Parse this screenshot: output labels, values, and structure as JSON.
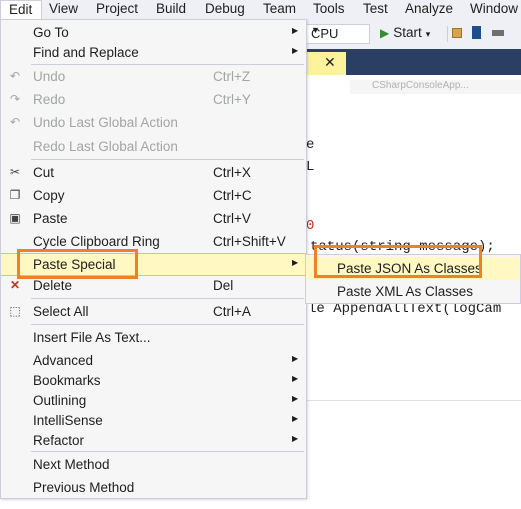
{
  "menubar": {
    "items": [
      "Edit",
      "View",
      "Project",
      "Build",
      "Debug",
      "Team",
      "Tools",
      "Test",
      "Analyze",
      "Window"
    ]
  },
  "toolbar": {
    "platform": "CPU",
    "start_label": "Start"
  },
  "editor": {
    "fragments": [
      "e",
      "L",
      "0",
      "tatus(string message);",
      "le AppendAllText(logCam"
    ],
    "crumb": "CSharpConsoleApp..."
  },
  "edit_menu": {
    "items": [
      {
        "label": "Go To",
        "shortcut": "",
        "submenu": true,
        "disabled": false,
        "icon": ""
      },
      {
        "label": "Find and Replace",
        "shortcut": "",
        "submenu": true,
        "disabled": false,
        "icon": ""
      },
      {
        "label": "Undo",
        "shortcut": "Ctrl+Z",
        "submenu": false,
        "disabled": true,
        "icon": "undo-icon"
      },
      {
        "label": "Redo",
        "shortcut": "Ctrl+Y",
        "submenu": false,
        "disabled": true,
        "icon": "redo-icon"
      },
      {
        "label": "Undo Last Global Action",
        "shortcut": "",
        "submenu": false,
        "disabled": true,
        "icon": "undo-global-icon"
      },
      {
        "label": "Redo Last Global Action",
        "shortcut": "",
        "submenu": false,
        "disabled": true,
        "icon": ""
      },
      {
        "label": "Cut",
        "shortcut": "Ctrl+X",
        "submenu": false,
        "disabled": false,
        "icon": "scissors-icon"
      },
      {
        "label": "Copy",
        "shortcut": "Ctrl+C",
        "submenu": false,
        "disabled": false,
        "icon": "copy-icon"
      },
      {
        "label": "Paste",
        "shortcut": "Ctrl+V",
        "submenu": false,
        "disabled": false,
        "icon": "paste-icon"
      },
      {
        "label": "Cycle Clipboard Ring",
        "shortcut": "Ctrl+Shift+V",
        "submenu": false,
        "disabled": false,
        "icon": ""
      },
      {
        "label": "Paste Special",
        "shortcut": "",
        "submenu": true,
        "disabled": false,
        "icon": ""
      },
      {
        "label": "Delete",
        "shortcut": "Del",
        "submenu": false,
        "disabled": false,
        "icon": "delete-x-icon"
      },
      {
        "label": "Select All",
        "shortcut": "Ctrl+A",
        "submenu": false,
        "disabled": false,
        "icon": "select-all-icon"
      },
      {
        "label": "Insert File As Text...",
        "shortcut": "",
        "submenu": false,
        "disabled": false,
        "icon": ""
      },
      {
        "label": "Advanced",
        "shortcut": "",
        "submenu": true,
        "disabled": false,
        "icon": ""
      },
      {
        "label": "Bookmarks",
        "shortcut": "",
        "submenu": true,
        "disabled": false,
        "icon": ""
      },
      {
        "label": "Outlining",
        "shortcut": "",
        "submenu": true,
        "disabled": false,
        "icon": ""
      },
      {
        "label": "IntelliSense",
        "shortcut": "",
        "submenu": true,
        "disabled": false,
        "icon": ""
      },
      {
        "label": "Refactor",
        "shortcut": "",
        "submenu": true,
        "disabled": false,
        "icon": ""
      },
      {
        "label": "Next Method",
        "shortcut": "",
        "submenu": false,
        "disabled": false,
        "icon": ""
      },
      {
        "label": "Previous Method",
        "shortcut": "",
        "submenu": false,
        "disabled": false,
        "icon": ""
      }
    ]
  },
  "paste_special_menu": {
    "items": [
      {
        "label": "Paste JSON As Classes"
      },
      {
        "label": "Paste XML As Classes"
      }
    ]
  },
  "colors": {
    "highlight_box": "#f08026",
    "hover_background": "#fff8c2",
    "menu_background": "#f6f6f6",
    "disabled_text": "#a2a4a5"
  }
}
